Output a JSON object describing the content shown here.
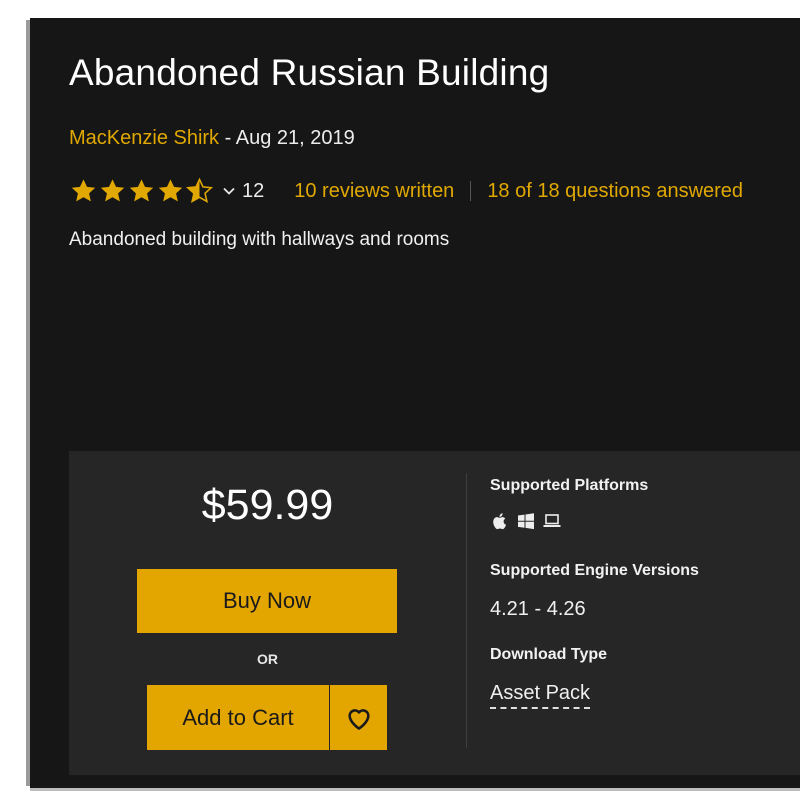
{
  "product": {
    "title": "Abandoned Russian Building",
    "author": "MacKenzie Shirk",
    "date_sep": " - ",
    "date": "Aug 21, 2019",
    "rating": {
      "stars_value": 4.5,
      "stars_max": 5,
      "count": "12"
    },
    "reviews_link": "10 reviews written",
    "questions_link": "18 of 18 questions answered",
    "description": "Abandoned building with hallways and rooms"
  },
  "purchase": {
    "price": "$59.99",
    "buy_now_label": "Buy Now",
    "or_label": "OR",
    "add_to_cart_label": "Add to Cart",
    "wishlist_icon": "heart-icon"
  },
  "info": {
    "platforms_heading": "Supported Platforms",
    "platform_icons": [
      "apple-icon",
      "windows-icon",
      "laptop-icon"
    ],
    "versions_heading": "Supported Engine Versions",
    "versions_value": "4.21 - 4.26",
    "download_heading": "Download Type",
    "download_value": "Asset Pack"
  },
  "colors": {
    "accent": "#e0a800",
    "button": "#e3a600",
    "background": "#161616",
    "panel": "#262626"
  }
}
